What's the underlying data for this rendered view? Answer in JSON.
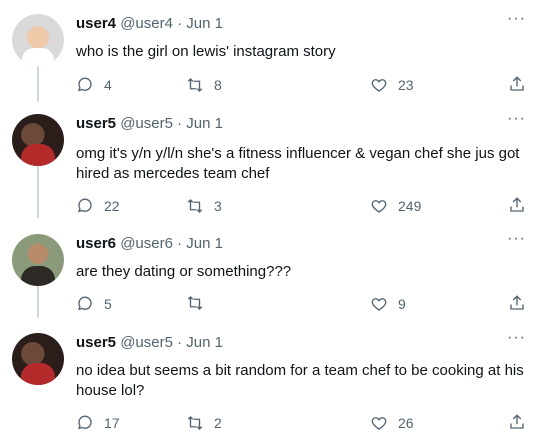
{
  "tweets": [
    {
      "name": "user4",
      "handle": "@user4",
      "date": "Jun 1",
      "text": "who is the girl on lewis' instagram story",
      "replies": "4",
      "retweets": "8",
      "likes": "23"
    },
    {
      "name": "user5",
      "handle": "@user5",
      "date": "Jun 1",
      "text": "omg it's y/n y/l/n she's a fitness influencer & vegan chef she jus got hired as mercedes team chef",
      "replies": "22",
      "retweets": "3",
      "likes": "249"
    },
    {
      "name": "user6",
      "handle": "@user6",
      "date": "Jun 1",
      "text": "are they dating or something???",
      "replies": "5",
      "retweets": "",
      "likes": "9"
    },
    {
      "name": "user5",
      "handle": "@user5",
      "date": "Jun 1",
      "text": "no idea but seems a bit random for a team chef to be cooking at his house lol?",
      "replies": "17",
      "retweets": "2",
      "likes": "26"
    }
  ],
  "ui": {
    "separator": "·",
    "more": "···"
  }
}
